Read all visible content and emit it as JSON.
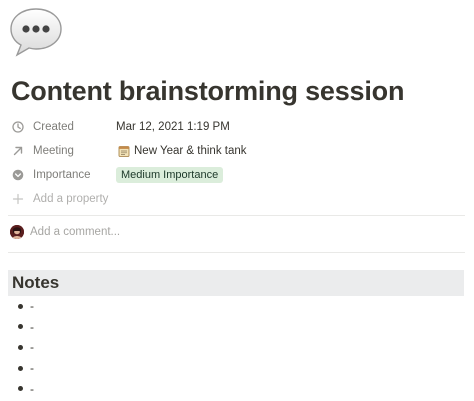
{
  "page": {
    "icon": "speech-bubble-icon",
    "title": "Content brainstorming session"
  },
  "properties": {
    "created": {
      "label": "Created",
      "icon": "clock-icon",
      "value": "Mar 12, 2021 1:19 PM"
    },
    "meeting": {
      "label": "Meeting",
      "icon": "arrow-up-right-icon",
      "value_icon": "notepad-icon",
      "value": "New Year & think tank"
    },
    "importance": {
      "label": "Importance",
      "icon": "circle-chevron-icon",
      "value": "Medium Importance",
      "tag_color": "#dbeddb"
    },
    "add_property": {
      "label": "Add a property",
      "icon": "plus-icon"
    }
  },
  "comments": {
    "placeholder": "Add a comment..."
  },
  "notes": {
    "heading": "Notes",
    "items": [
      "-",
      "-",
      "-",
      "-",
      "-"
    ]
  },
  "colors": {
    "text": "#37352f",
    "heading_bg": "#ebeced",
    "divider": "#e9e9e7"
  }
}
